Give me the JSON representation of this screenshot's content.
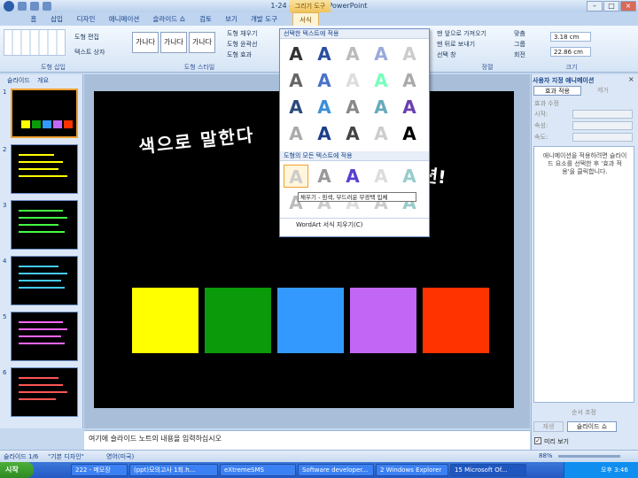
{
  "window": {
    "title": "1-24 - Microsoft PowerPoint",
    "context_tab": "그리기 도구"
  },
  "tabs": [
    {
      "label": "홈"
    },
    {
      "label": "삽입"
    },
    {
      "label": "디자인"
    },
    {
      "label": "애니메이션"
    },
    {
      "label": "슬라이드 쇼"
    },
    {
      "label": "검토"
    },
    {
      "label": "보기"
    },
    {
      "label": "개발 도구"
    },
    {
      "label": "서식"
    }
  ],
  "ribbon": {
    "shape_insert": {
      "label": "도형 삽입",
      "edit_shape": "도형 편집",
      "textbox": "텍스트 상자"
    },
    "shape_style": {
      "label": "도형 스타일",
      "style_text": "가나다",
      "fill": "도형 채우기",
      "outline": "도형 윤곽선",
      "effect": "도형 효과"
    },
    "arrange": {
      "label": "정렬",
      "bring_front": "맨 앞으로 가져오기",
      "send_back": "맨 뒤로 보내기",
      "selection_pane": "선택 창",
      "align": "맞춤",
      "group": "그룹",
      "rotate": "회전"
    },
    "size": {
      "label": "크기",
      "height": "3.18 cm",
      "width": "22.86 cm"
    }
  },
  "gallery": {
    "section1": "선택한 텍스트에 적용",
    "section2": "도형의 모든 텍스트에 적용",
    "glyph": "A",
    "tooltip": "채우기 - 흰색, 부드러운 무광택 입체",
    "clear": "WordArt 서식 지우기(C)"
  },
  "slide_panel": {
    "tabs": [
      "슬라이드",
      "개요"
    ],
    "numbers": [
      "1",
      "2",
      "3",
      "4",
      "5",
      "6"
    ]
  },
  "slide": {
    "title_left": "색으로 말한다",
    "title_right": "션!",
    "colors": [
      "#ffff00",
      "#0a9a0a",
      "#3399ff",
      "#c266f5",
      "#ff3300"
    ]
  },
  "notes": {
    "placeholder": "여기에 슬라이드 노트의 내용을 입력하십시오"
  },
  "task_pane": {
    "title": "사용자 지정 애니메이션",
    "add_effect": "효과 적용",
    "remove": "제거",
    "modify_label": "효과 수정",
    "start_label": "시작:",
    "property_label": "속성:",
    "speed_label": "속도:",
    "hint": "애니메이션을 적용하려면 슬라이드 요소를 선택한 후 '효과 적용'을 클릭합니다.",
    "reorder": "순서 조정",
    "play": "재생",
    "slideshow": "슬라이드 쇼",
    "autopreview": "미리 보기"
  },
  "status": {
    "slide_num": "슬라이드 1/6",
    "theme": "\"기본 디자인\"",
    "language": "영어(미국)",
    "zoom": "88%"
  },
  "taskbar": {
    "start": "시작",
    "tasks": [
      "222 - 메모장",
      "(ppt)모의고사 1회.h...",
      "eXtremeSMS",
      "Software developer...",
      "2 Windows Explorer",
      "15 Microsoft Of..."
    ],
    "clock": "오후 3:46"
  }
}
